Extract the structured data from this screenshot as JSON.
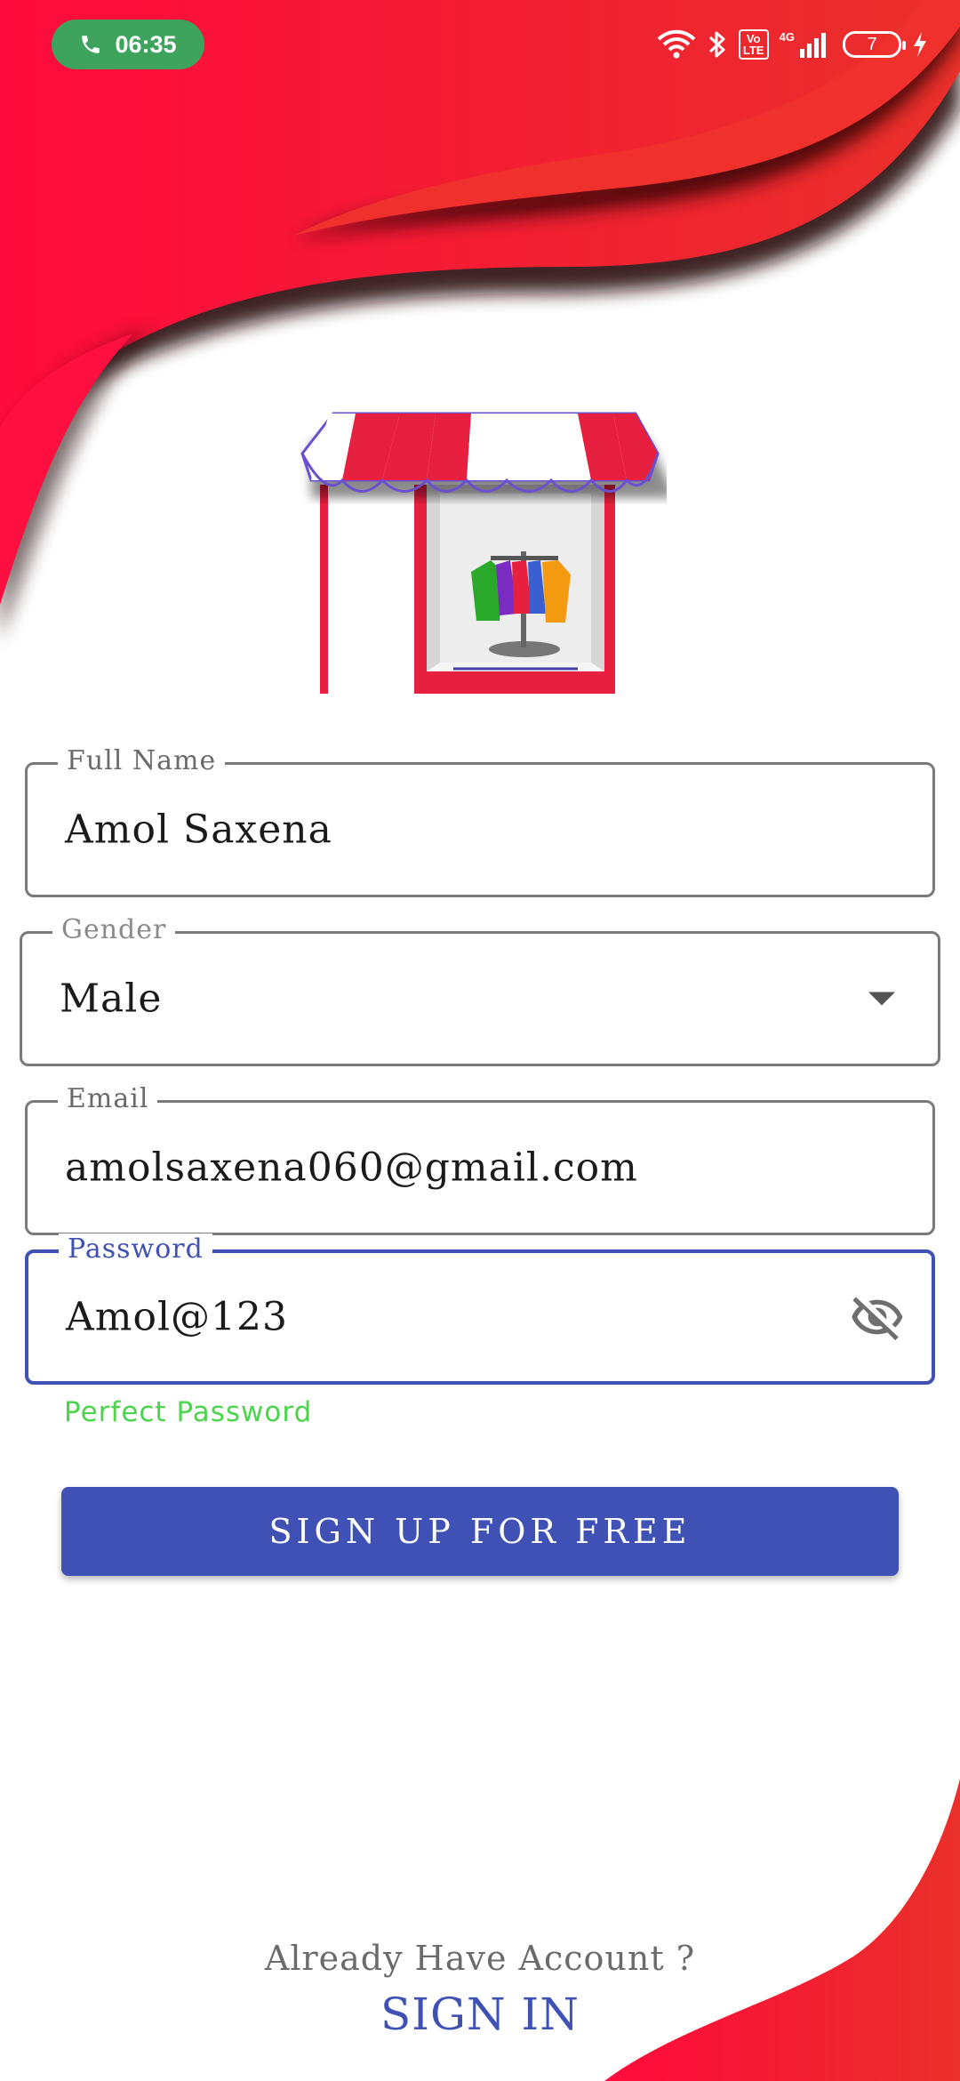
{
  "status_bar": {
    "call_time": "06:35",
    "network_type": "4G",
    "volte_label": "Vo LTE",
    "battery_level": "7",
    "icons": [
      "phone-icon",
      "wifi-icon",
      "bluetooth-icon",
      "volte-icon",
      "signal-icon",
      "battery-icon",
      "charging-icon"
    ]
  },
  "colors": {
    "accent": "#3f51b5",
    "wave_red": "#e8262e",
    "helper_green": "#4cd44c",
    "call_pill_green": "#3da35d"
  },
  "form": {
    "full_name": {
      "label": "Full Name",
      "value": "Amol Saxena"
    },
    "gender": {
      "label": "Gender",
      "value": "Male"
    },
    "email": {
      "label": "Email",
      "value": "amolsaxena060@gmail.com"
    },
    "password": {
      "label": "Password",
      "value": "Amol@123",
      "helper": "Perfect Password"
    },
    "submit_label": "SIGN UP FOR FREE"
  },
  "footer": {
    "prompt": "Already Have Account ?",
    "link_label": "SIGN IN"
  }
}
